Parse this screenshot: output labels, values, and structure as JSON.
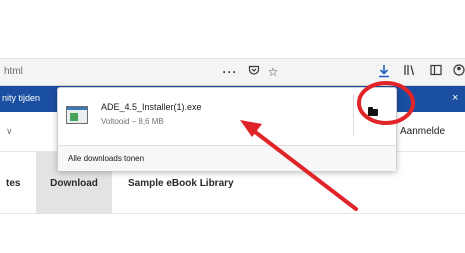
{
  "browser": {
    "url_fragment": "html",
    "icons": {
      "more": "more-actions-icon",
      "pocket": "pocket-icon",
      "bookmark": "bookmark-star-icon",
      "download": "download-arrow-icon",
      "library": "library-icon",
      "sidebar": "sidebar-icon",
      "account": "account-icon"
    }
  },
  "banner": {
    "text": "nity tijden",
    "close": "×",
    "color": "#1a4ea0"
  },
  "menu": {
    "chevron": "∨",
    "login": "Aanmelde"
  },
  "nav": {
    "items": [
      {
        "label": "tes"
      },
      {
        "label": "Download"
      },
      {
        "label": "Sample eBook Library"
      }
    ]
  },
  "downloads_panel": {
    "filename": "ADE_4.5_Installer(1).exe",
    "status": "Voltooid – 8,6 MB",
    "show_all": "Alle downloads tonen",
    "footer_underline_letter": "A"
  },
  "annotation": {
    "color": "#e0242a"
  }
}
